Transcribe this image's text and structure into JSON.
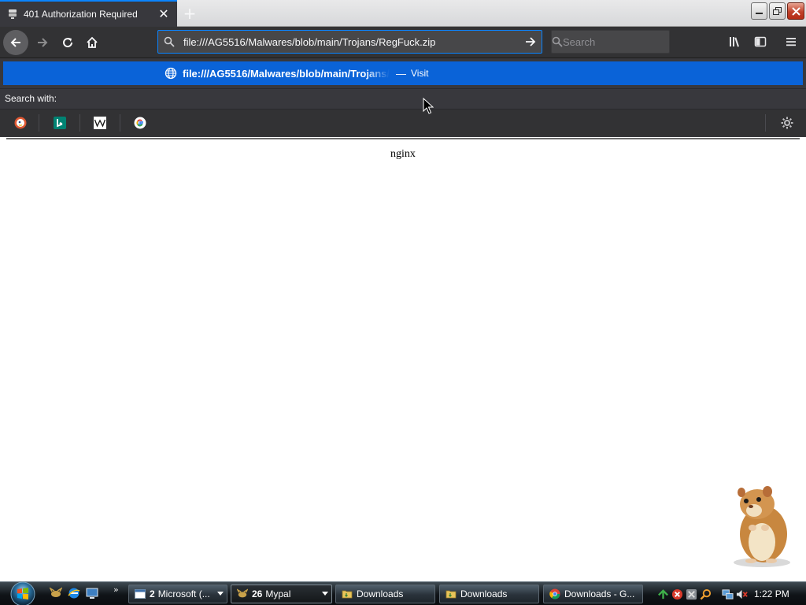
{
  "browser": {
    "tab": {
      "title": "401 Authorization Required",
      "close_icon": "close-icon",
      "favicon_icon": "server-page-icon"
    },
    "new_tab_symbol": "+",
    "nav": {
      "back_icon": "back-arrow-icon",
      "forward_icon": "forward-arrow-icon",
      "reload_icon": "reload-icon",
      "home_icon": "home-icon"
    },
    "urlbar": {
      "value": "file:///AG5516/Malwares/blob/main/Trojans/RegFuck.zip",
      "go_icon": "go-arrow-icon"
    },
    "searchbar": {
      "placeholder": "Search"
    },
    "toolbar_icons": [
      "library-icon",
      "sidebar-icon",
      "hamburger-menu-icon"
    ],
    "suggestion": {
      "url": "file:///AG5516/Malwares/blob/main/Trojans/",
      "separator": "—",
      "action": "Visit"
    },
    "search_with_label": "Search with:",
    "search_engines": [
      "DuckDuckGo",
      "Bing",
      "Wikipedia",
      "Google"
    ]
  },
  "page": {
    "body_text": "nginx"
  },
  "taskbar": {
    "tasks": [
      {
        "count": "2",
        "label": "Microsoft (...",
        "icon": "window-icon",
        "has_arrow": true
      },
      {
        "count": "26",
        "label": "Mypal",
        "icon": "mypal-icon",
        "has_arrow": true,
        "active": true
      },
      {
        "count": "",
        "label": "Downloads",
        "icon": "folder-icon",
        "has_arrow": false
      },
      {
        "count": "",
        "label": "Downloads",
        "icon": "folder-icon",
        "has_arrow": false
      },
      {
        "count": "",
        "label": "Downloads - G...",
        "icon": "chrome-icon",
        "has_arrow": false
      }
    ],
    "chevron": "»",
    "clock": "1:22 PM"
  },
  "colors": {
    "accent": "#0a84ff",
    "suggestion_bg": "#0a63d8",
    "toolbar_bg": "#323234",
    "tab_bg": "#38383d"
  }
}
